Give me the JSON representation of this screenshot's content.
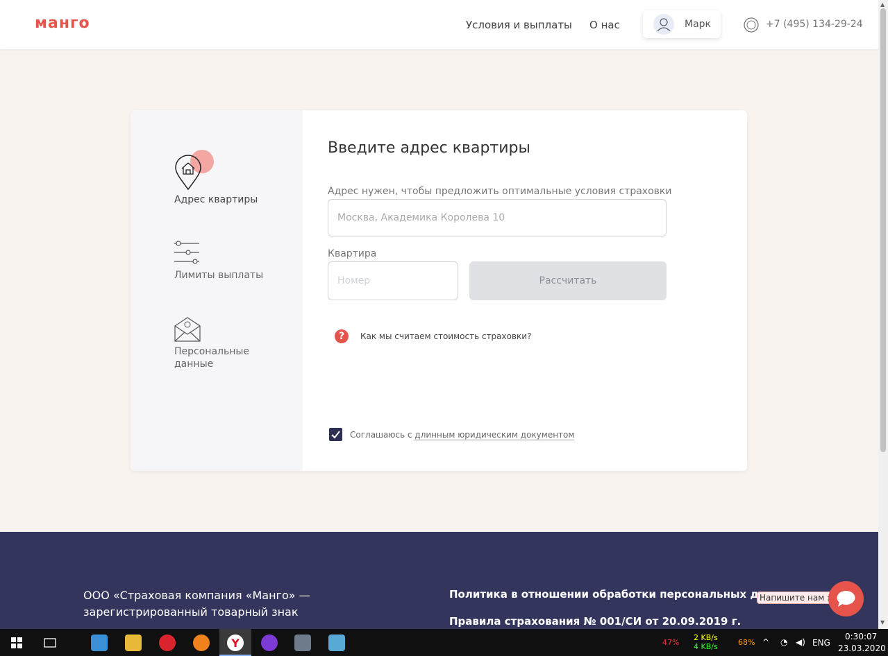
{
  "header": {
    "logo": "манго",
    "nav": [
      "Условия и выплаты",
      "О нас"
    ],
    "user_name": "Марк",
    "phone": "+7 (495) 134-29-24"
  },
  "steps": [
    {
      "label": "Адрес квартиры",
      "icon": "home-pin-icon",
      "active": true
    },
    {
      "label": "Лимиты выплаты",
      "icon": "sliders-icon",
      "active": false
    },
    {
      "label": "Персональные данные",
      "icon": "envelope-icon",
      "active": false
    }
  ],
  "form": {
    "title": "Введите адрес квартиры",
    "address_label": "Адрес нужен, чтобы предложить оптимальные условия страховки",
    "address_placeholder": "Москва, Академика Королева 10",
    "apartment_label": "Квартира",
    "apartment_placeholder": "Номер",
    "calculate_label": "Рассчитать",
    "help_text": "Как мы считаем стоимость страховки?",
    "agree_prefix": "Соглашаюсь с ",
    "agree_link": "длинным юридическим документом",
    "agree_checked": true
  },
  "footer": {
    "company_line1": "ООО «Страховая компания «Манго» —",
    "company_line2": "зарегистрированный товарный знак",
    "links": [
      "Политика в отношении обработки персональных данных",
      "Правила страхования № 001/СИ от 20.09.2019 г."
    ],
    "chat_tip": "Напишите нам :)"
  },
  "taskbar": {
    "cpu": "47%",
    "net_up": "2 KB/s",
    "net_down": "4 KB/s",
    "mem": "68%",
    "lang": "ENG",
    "time": "0:30:07",
    "date": "23.03.2020"
  },
  "colors": {
    "accent": "#e5534b",
    "footer": "#34355d",
    "background": "#f8f3ef"
  }
}
